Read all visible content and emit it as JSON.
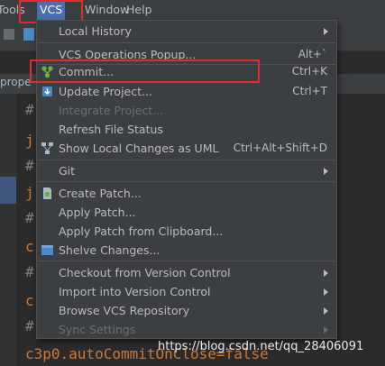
{
  "menubar": {
    "items": [
      {
        "label": "Tools"
      },
      {
        "label": "VCS"
      },
      {
        "label": "Window"
      },
      {
        "label": "Help"
      }
    ]
  },
  "background": {
    "tab_label": "prope",
    "code_lines": [
      {
        "text": "#",
        "kind": "hash"
      },
      {
        "text": "j",
        "kind": "key"
      },
      {
        "text": "#",
        "kind": "hash"
      },
      {
        "text": "j",
        "kind": "key"
      },
      {
        "text": "#",
        "kind": "hash"
      },
      {
        "text": "c",
        "kind": "key"
      },
      {
        "text": "#",
        "kind": "hash"
      },
      {
        "text": "c",
        "kind": "key"
      },
      {
        "text": "#",
        "kind": "hash"
      }
    ],
    "bottom_code": "c3p0.autoCommitOnClose=false"
  },
  "menu": {
    "local_history": "Local History",
    "vcs_popup": "VCS Operations Popup...",
    "vcs_popup_sc": "Alt+`",
    "commit": "Commit...",
    "commit_sc": "Ctrl+K",
    "update": "Update Project...",
    "update_sc": "Ctrl+T",
    "integrate": "Integrate Project...",
    "refresh": "Refresh File Status",
    "show_changes": "Show Local Changes as UML",
    "show_changes_sc": "Ctrl+Alt+Shift+D",
    "git": "Git",
    "create_patch": "Create Patch...",
    "apply_patch": "Apply Patch...",
    "apply_clipboard": "Apply Patch from Clipboard...",
    "shelve": "Shelve Changes...",
    "checkout": "Checkout from Version Control",
    "import": "Import into Version Control",
    "browse": "Browse VCS Repository",
    "sync": "Sync Settings"
  },
  "watermark": "https://blog.csdn.net/qq_28406091",
  "colors": {
    "menu_bg": "#3c3f41",
    "active_menu": "#4b6eaf",
    "highlight_box": "#e32b2b",
    "commit_icon": "#62b543"
  }
}
